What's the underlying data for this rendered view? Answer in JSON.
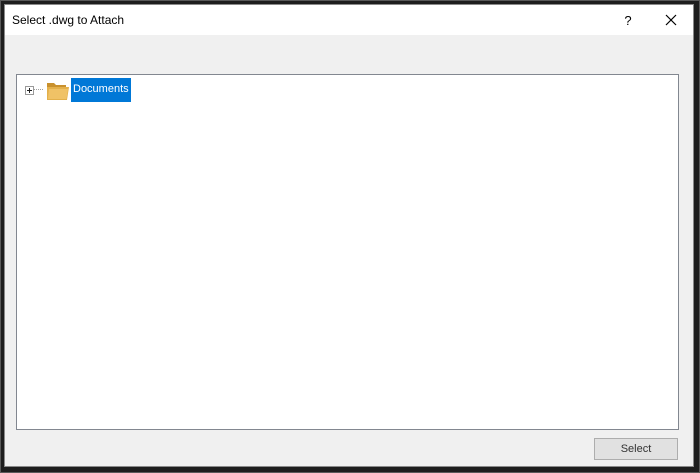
{
  "window": {
    "title": "Select .dwg to Attach",
    "help_label": "?"
  },
  "tree": {
    "nodes": [
      {
        "label": "Documents",
        "icon": "folder-icon",
        "selected": true,
        "expanded": false
      }
    ]
  },
  "footer": {
    "select_label": "Select"
  },
  "colors": {
    "selection": "#0078d7",
    "panel_bg": "#ffffff",
    "dialog_bg": "#f0f0f0",
    "folder": "#e3b04b"
  }
}
